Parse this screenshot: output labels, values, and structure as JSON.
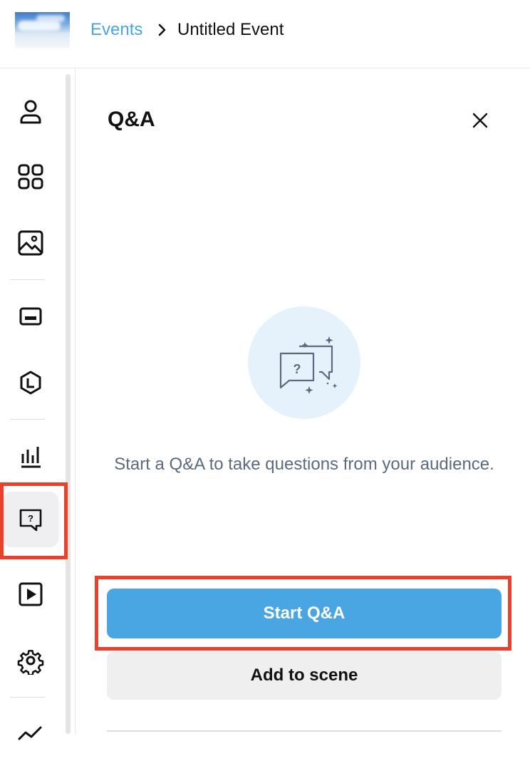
{
  "header": {
    "breadcrumb_root": "Events",
    "breadcrumb_current": "Untitled Event"
  },
  "sidebar": {
    "items": [
      {
        "icon": "person-icon"
      },
      {
        "icon": "grid-icon"
      },
      {
        "icon": "image-icon"
      },
      {
        "icon": "banner-icon"
      },
      {
        "icon": "logo-badge-icon"
      },
      {
        "icon": "poll-icon"
      },
      {
        "icon": "qa-icon",
        "active": true
      },
      {
        "icon": "play-icon"
      },
      {
        "icon": "gear-icon"
      },
      {
        "icon": "analytics-icon"
      }
    ]
  },
  "panel": {
    "title": "Q&A",
    "empty_message": "Start a Q&A to take questions from your audience.",
    "start_label": "Start Q&A",
    "add_label": "Add to scene"
  },
  "colors": {
    "accent": "#4aa6e3",
    "highlight": "#e8412c",
    "muted_text": "#5b6b7d"
  }
}
